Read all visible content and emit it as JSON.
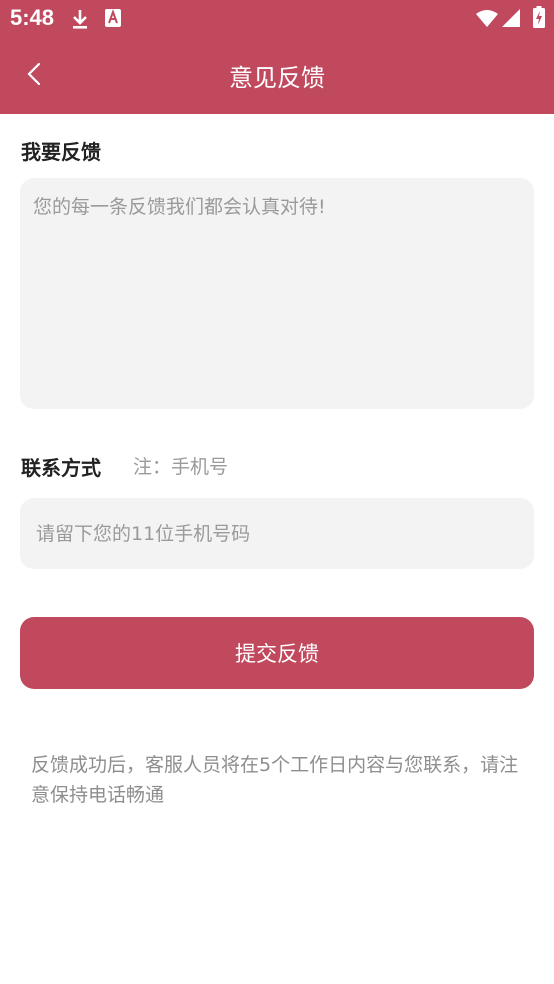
{
  "status_bar": {
    "time": "5:48"
  },
  "header": {
    "title": "意见反馈"
  },
  "feedback": {
    "label": "我要反馈",
    "placeholder": "您的每一条反馈我们都会认真对待!"
  },
  "contact": {
    "label": "联系方式",
    "note": "注：手机号",
    "placeholder": "请留下您的11位手机号码"
  },
  "submit": {
    "label": "提交反馈"
  },
  "footer": {
    "text": "反馈成功后，客服人员将在5个工作日内容与您联系，请注意保持电话畅通"
  },
  "colors": {
    "brand": "#c0495e",
    "input_bg": "#f3f3f3",
    "placeholder": "#9a9a9a"
  }
}
